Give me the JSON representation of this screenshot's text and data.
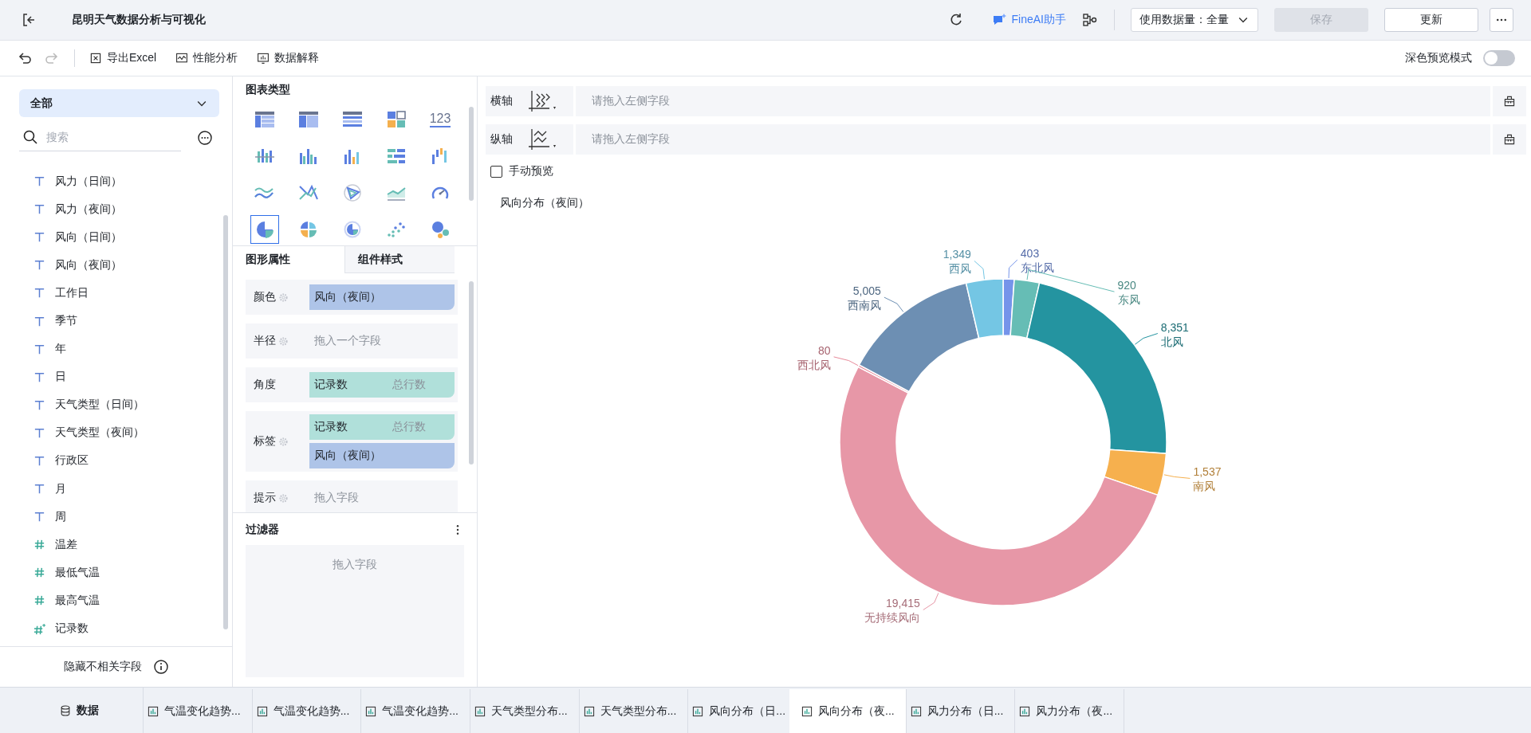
{
  "header": {
    "title": "昆明天气数据分析与可视化",
    "assistant_button": "FineAI助手",
    "data_amount": "使用数据量：全量",
    "save_button": {
      "label": "保存",
      "disabled": true
    },
    "update_button": {
      "label": "更新",
      "disabled": false
    }
  },
  "toolbar": {
    "undo": {
      "disabled": false
    },
    "redo": {
      "disabled": true
    },
    "buttons": [
      {
        "label": "导出Excel",
        "kind": "excel"
      },
      {
        "label": "性能分析",
        "kind": "performance"
      },
      {
        "label": "数据解释",
        "kind": "explain"
      }
    ],
    "dark_preview": {
      "label": "深色预览模式",
      "on": false
    }
  },
  "fields_panel": {
    "filter": "全部",
    "search_placeholder": "搜索",
    "fields": [
      {
        "label": "风力（日间）",
        "kind": "text"
      },
      {
        "label": "风力（夜间）",
        "kind": "text"
      },
      {
        "label": "风向（日间）",
        "kind": "text"
      },
      {
        "label": "风向（夜间）",
        "kind": "text"
      },
      {
        "label": "工作日",
        "kind": "text"
      },
      {
        "label": "季节",
        "kind": "text"
      },
      {
        "label": "年",
        "kind": "text"
      },
      {
        "label": "日",
        "kind": "text"
      },
      {
        "label": "天气类型（日间）",
        "kind": "text"
      },
      {
        "label": "天气类型（夜间）",
        "kind": "text"
      },
      {
        "label": "行政区",
        "kind": "text"
      },
      {
        "label": "月",
        "kind": "text"
      },
      {
        "label": "周",
        "kind": "text"
      },
      {
        "label": "温差",
        "kind": "number"
      },
      {
        "label": "最低气温",
        "kind": "number"
      },
      {
        "label": "最高气温",
        "kind": "number"
      },
      {
        "label": "记录数",
        "kind": "count"
      }
    ],
    "footer": "隐藏不相关字段"
  },
  "chart_types": {
    "title": "图表类型",
    "items": [
      {
        "kind": "table",
        "selected": false
      },
      {
        "kind": "cross-table",
        "selected": false
      },
      {
        "kind": "detail-table",
        "selected": false
      },
      {
        "kind": "tiles",
        "selected": false
      },
      {
        "kind": "number",
        "label": "123",
        "selected": false
      },
      {
        "kind": "range-bar",
        "selected": false
      },
      {
        "kind": "grouped-bar",
        "selected": false
      },
      {
        "kind": "color-bar",
        "selected": false
      },
      {
        "kind": "horizontal-bar",
        "selected": false
      },
      {
        "kind": "floating-bar",
        "selected": false
      },
      {
        "kind": "line",
        "selected": false
      },
      {
        "kind": "cross-line",
        "selected": false
      },
      {
        "kind": "radar",
        "selected": false
      },
      {
        "kind": "area",
        "selected": false
      },
      {
        "kind": "gauge",
        "selected": false
      },
      {
        "kind": "pie",
        "selected": true
      },
      {
        "kind": "rose",
        "selected": false
      },
      {
        "kind": "ring",
        "selected": false
      },
      {
        "kind": "scatter",
        "selected": false
      },
      {
        "kind": "bubble",
        "selected": false
      }
    ]
  },
  "property_tabs": [
    {
      "label": "图形属性",
      "selected": true
    },
    {
      "label": "组件样式",
      "selected": false
    }
  ],
  "properties": [
    {
      "label": "颜色",
      "settings": true,
      "fields": [
        {
          "kind": "dimension",
          "text": "风向（夜间）"
        }
      ]
    },
    {
      "label": "半径",
      "settings": true,
      "placeholder": "拖入一个字段"
    },
    {
      "label": "角度",
      "settings": false,
      "fields": [
        {
          "kind": "measure",
          "text": "记录数",
          "aggregate": "总行数"
        }
      ]
    },
    {
      "label": "标签",
      "settings": true,
      "fields": [
        {
          "kind": "measure",
          "text": "记录数",
          "aggregate": "总行数"
        },
        {
          "kind": "dimension",
          "text": "风向（夜间）"
        }
      ]
    },
    {
      "label": "提示",
      "settings": true,
      "placeholder": "拖入字段"
    }
  ],
  "filter_panel": {
    "title": "过滤器",
    "placeholder": "拖入字段"
  },
  "canvas": {
    "axes": [
      {
        "label": "横轴",
        "kind": "x",
        "placeholder": "请拖入左侧字段"
      },
      {
        "label": "纵轴",
        "kind": "y",
        "placeholder": "请拖入左侧字段"
      }
    ],
    "manual_preview": {
      "label": "手动预览",
      "checked": false
    },
    "chart": {
      "title": "风向分布（夜间）",
      "chart_data": {
        "type": "donut",
        "categories": [
          "东北风",
          "东风",
          "北风",
          "南风",
          "无持续风向",
          "西北风",
          "西南风",
          "西风"
        ],
        "values": [
          403,
          920,
          8351,
          1537,
          19415,
          80,
          5005,
          1349
        ],
        "value_labels": [
          "403",
          "920",
          "8,351",
          "1,537",
          "19,415",
          "80",
          "5,005",
          "1,349"
        ]
      }
    }
  },
  "bottom_tabs": [
    {
      "label": "数据",
      "kind": "data",
      "selected": false
    },
    {
      "label": "气温变化趋势...",
      "kind": "chart",
      "selected": false
    },
    {
      "label": "气温变化趋势...",
      "kind": "chart",
      "selected": false
    },
    {
      "label": "气温变化趋势...",
      "kind": "chart",
      "selected": false
    },
    {
      "label": "天气类型分布...",
      "kind": "chart",
      "selected": false
    },
    {
      "label": "天气类型分布...",
      "kind": "chart",
      "selected": false
    },
    {
      "label": "风向分布（日...",
      "kind": "chart",
      "selected": false
    },
    {
      "label": "风向分布（夜...",
      "kind": "chart",
      "selected": true
    },
    {
      "label": "风力分布（日...",
      "kind": "chart",
      "selected": false
    },
    {
      "label": "风力分布（夜...",
      "kind": "chart",
      "selected": false
    }
  ]
}
